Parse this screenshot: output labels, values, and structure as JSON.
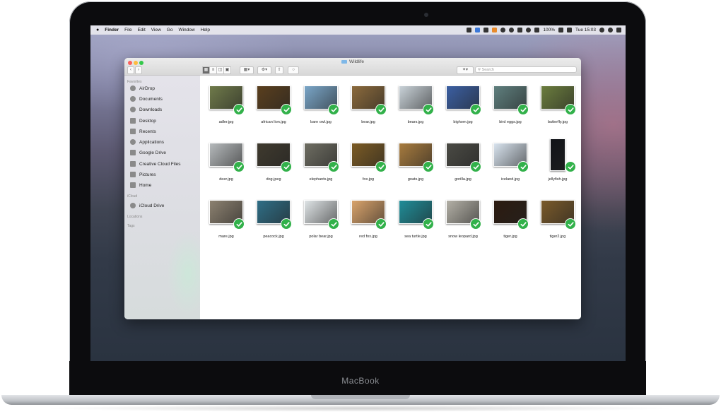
{
  "device": {
    "label": "MacBook"
  },
  "menubar": {
    "apple": "",
    "items": [
      "Finder",
      "File",
      "Edit",
      "View",
      "Go",
      "Window",
      "Help"
    ],
    "battery": "100%",
    "clock": "Tue 15:03"
  },
  "window": {
    "title": "Wildlife",
    "search_placeholder": "Search"
  },
  "sidebar": {
    "sections": [
      "Favorites",
      "iCloud",
      "Locations",
      "Tags"
    ],
    "favorites": [
      "AirDrop",
      "Documents",
      "Downloads",
      "Desktop",
      "Recents",
      "Applications",
      "Google Drive",
      "Creative Cloud Files",
      "Pictures",
      "Home"
    ],
    "icloud": [
      "iCloud Drive"
    ]
  },
  "files": [
    {
      "name": "adler.jpg",
      "color": "#6f7a4a"
    },
    {
      "name": "african lion.jpg",
      "color": "#5a3f1e"
    },
    {
      "name": "barn owl.jpg",
      "color": "#7aa6c8"
    },
    {
      "name": "bear.jpg",
      "color": "#8b6a3c"
    },
    {
      "name": "bears.jpg",
      "color": "#c9d2d8"
    },
    {
      "name": "bighorn.jpg",
      "color": "#3b5fa2"
    },
    {
      "name": "bird eggs.jpg",
      "color": "#5f7f7e"
    },
    {
      "name": "butterfly.jpg",
      "color": "#6b7d3e"
    },
    {
      "name": "deer.jpg",
      "color": "#b5b9bb"
    },
    {
      "name": "dog.jpeg",
      "color": "#3f3a2e"
    },
    {
      "name": "elephants.jpg",
      "color": "#6e6d62"
    },
    {
      "name": "fox.jpg",
      "color": "#7b5b24"
    },
    {
      "name": "goats.jpg",
      "color": "#a77b3e"
    },
    {
      "name": "gorilla.jpg",
      "color": "#4a4a44"
    },
    {
      "name": "iceland.jpg",
      "color": "#d8e3ee"
    },
    {
      "name": "jellyfish.jpg",
      "color": "#111318"
    },
    {
      "name": "mare.jpg",
      "color": "#8c8170"
    },
    {
      "name": "peacock.jpg",
      "color": "#2f6e86"
    },
    {
      "name": "polar bear.jpg",
      "color": "#dfe4e6"
    },
    {
      "name": "red fox.jpg",
      "color": "#d9a36b"
    },
    {
      "name": "sea turtle.jpg",
      "color": "#1f8d98"
    },
    {
      "name": "snow leopard.jpg",
      "color": "#b3b0a6"
    },
    {
      "name": "tiger.jpg",
      "color": "#2c1b10"
    },
    {
      "name": "tiger2.jpg",
      "color": "#7a5a2a"
    }
  ]
}
